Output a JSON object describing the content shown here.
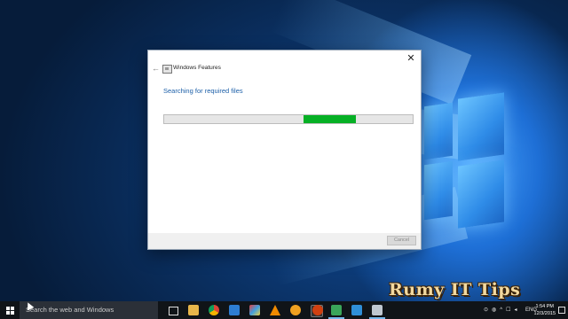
{
  "dialog": {
    "title": "Windows Features",
    "heading": "Searching for required files",
    "progress": {
      "segment_start": 0.56,
      "segment_end": 0.77,
      "color": "#06b025"
    },
    "cancel_label": "Cancel",
    "close_glyph": "✕",
    "back_glyph": "←"
  },
  "taskbar": {
    "search_placeholder": "Search the web and Windows",
    "icons": [
      "task-view-icon",
      "file-explorer-icon",
      "chrome-icon",
      "store-icon",
      "paint-icon",
      "vlc-icon",
      "media-player-icon",
      "app-icon",
      "ccleaner-icon",
      "camtasia-icon",
      "app2-icon",
      "app3-icon"
    ],
    "tray": {
      "language": "ENG",
      "time": "1:54 PM",
      "date": "12/3/2015"
    }
  },
  "watermark": "Rumy IT Tips",
  "colors": {
    "accent": "#1c5fa8",
    "taskbar": "#101418",
    "desktop": "#0b2a52"
  }
}
